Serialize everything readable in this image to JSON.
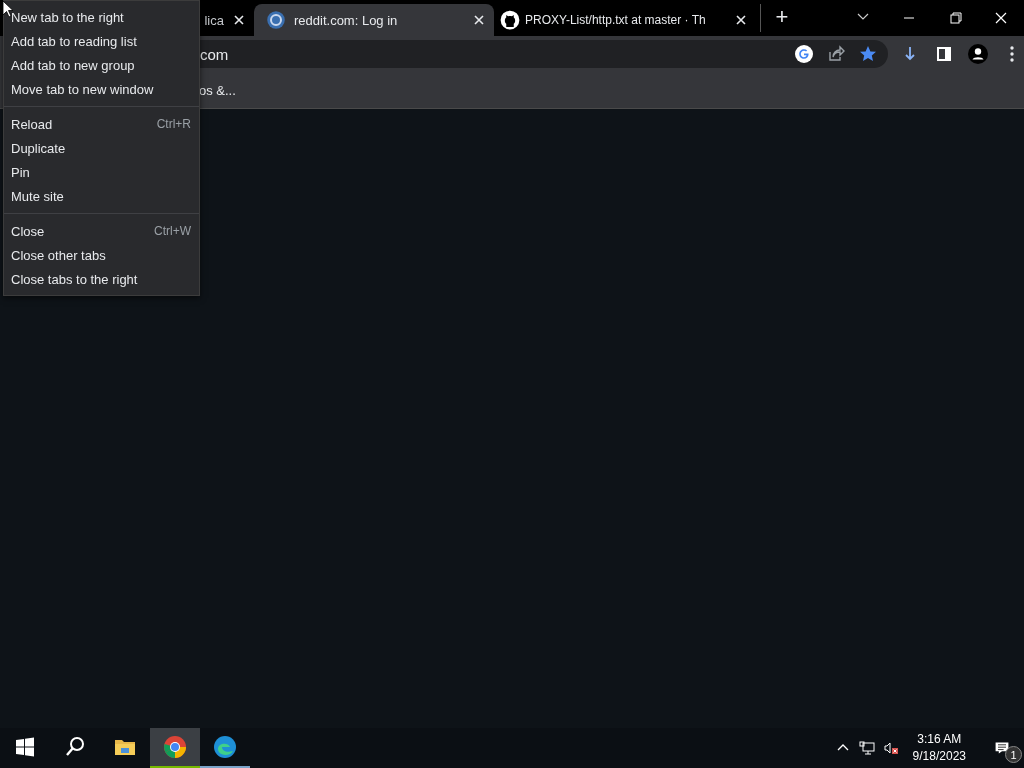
{
  "tabs": [
    {
      "title": "lica",
      "selected": false,
      "kind": "plain"
    },
    {
      "title": "reddit.com: Log in",
      "selected": true,
      "kind": "reddit"
    },
    {
      "title": "PROXY-List/http.txt at master · Th",
      "selected": false,
      "kind": "github"
    }
  ],
  "new_tab": "+",
  "omnibox": {
    "value": "com"
  },
  "bookmarks_bar": [
    "os &..."
  ],
  "context_menu": [
    [
      {
        "label": "New tab to the right"
      },
      {
        "label": "Add tab to reading list"
      },
      {
        "label": "Add tab to new group"
      },
      {
        "label": "Move tab to new window"
      }
    ],
    [
      {
        "label": "Reload",
        "shortcut": "Ctrl+R"
      },
      {
        "label": "Duplicate"
      },
      {
        "label": "Pin"
      },
      {
        "label": "Mute site"
      }
    ],
    [
      {
        "label": "Close",
        "shortcut": "Ctrl+W"
      },
      {
        "label": "Close other tabs"
      },
      {
        "label": "Close tabs to the right"
      }
    ]
  ],
  "taskbar": {
    "apps": [
      {
        "kind": "start",
        "selected": false,
        "running": false
      },
      {
        "kind": "search",
        "selected": false,
        "running": false
      },
      {
        "kind": "explorer",
        "selected": false,
        "running": false
      },
      {
        "kind": "chrome",
        "selected": true,
        "running": true
      },
      {
        "kind": "edge",
        "selected": false,
        "running": true
      }
    ],
    "time": "3:16 AM",
    "date": "9/18/2023",
    "notifications": "1"
  }
}
